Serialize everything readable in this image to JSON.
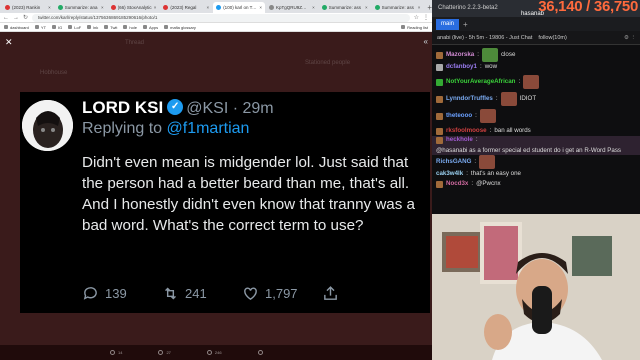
{
  "browser": {
    "tabs": [
      {
        "label": "(2023) Rankin",
        "fav": "#d33"
      },
      {
        "label": "Summarize: ana",
        "fav": "#2a6"
      },
      {
        "label": "(66) StoxAnalytic",
        "fav": "#d33"
      },
      {
        "label": "(2023) Regal",
        "fav": "#d33"
      },
      {
        "label": "(100) karl on Twit",
        "fav": "#1d9bf0",
        "active": true
      },
      {
        "label": "KpTgQRU9ZW8hH",
        "fav": "#888"
      },
      {
        "label": "Summarize: ass",
        "fav": "#2a6"
      },
      {
        "label": "Summarize: ass",
        "fav": "#2a6"
      }
    ],
    "url": "twitter.com/karl/reply/status/1375636869185290616/photo/1",
    "bookmarks": [
      "dashboard",
      "YT",
      "IG",
      "LoF",
      "lnk",
      "Twit",
      "hole",
      "Apps",
      "mafia glossary"
    ],
    "reading_list": "Reading list"
  },
  "page": {
    "close_icon": "close-icon",
    "ghost_thread": "Thread",
    "ghost_left": "Hobhouse",
    "ghost_right": "Stationed people",
    "tweet": {
      "display_name": "LORD KSI",
      "handle": "@KSI",
      "time": "· 29m",
      "replying_prefix": "Replying to",
      "replying_to": "@f1martian",
      "text": "Didn't even mean is midgender lol. Just said that the person had a better beard than me, that's all. And I honestly didn't even know that tranny was a bad word. What's the correct term to use?",
      "replies": "139",
      "retweets": "241",
      "likes": "1,797"
    },
    "status_counts": [
      "14",
      "27",
      "246"
    ]
  },
  "chatterino": {
    "title": "Chatterino 2.2.3-beta2",
    "streamer": "hasanab",
    "counter": "36,140 / 36,750",
    "tab": "main",
    "channel_header": "anabi (live) - 5h 5m - 19806 - Just Chat",
    "follow": "follow(10m)",
    "messages": [
      {
        "user": "Mazorska",
        "color": "#d08ad2",
        "text": "close",
        "badge": "#a06a3a",
        "emote": "pepe"
      },
      {
        "user": "dcfanboy1",
        "color": "#9a7cf0",
        "text": "wow",
        "badge": "#aaa"
      },
      {
        "user": "NotYourAverageAfrican",
        "color": "#3ad13a",
        "text": "",
        "badge": "#3a3",
        "emote": "face",
        "tall": true
      },
      {
        "user": "LynndorTruffles",
        "color": "#7aaaf0",
        "text": "IDIOT",
        "badge": "#a06a3a",
        "emote": "face"
      },
      {
        "user": "theteooo",
        "color": "#6aa0ff",
        "text": "",
        "badge": "#a06a3a",
        "emote": "face",
        "tall": true
      },
      {
        "user": "rksfoolmoose",
        "color": "#d04040",
        "text": "ban all words",
        "badge": "#a06a3a"
      },
      {
        "user": "heckhole",
        "color": "#a05ad0",
        "text": "@hasanabi as a former special ed student do i get an R-Word Pass",
        "badge": "#a06a3a",
        "highlight": true
      },
      {
        "user": "RichsGANG",
        "color": "#7aaaf0",
        "text": "",
        "badge": "",
        "emote": "face"
      },
      {
        "user": "cak3w4lk",
        "color": "#9ad0f0",
        "text": "that's an easy one",
        "badge": ""
      },
      {
        "user": "Nocd3x",
        "color": "#d06aa0",
        "text": "@Pwcnx",
        "badge": "#a06a3a"
      }
    ]
  },
  "colors": {
    "accent": "#1d9bf0",
    "counter": "#ff6a3d",
    "modal_bg": "#3a1b1b"
  }
}
